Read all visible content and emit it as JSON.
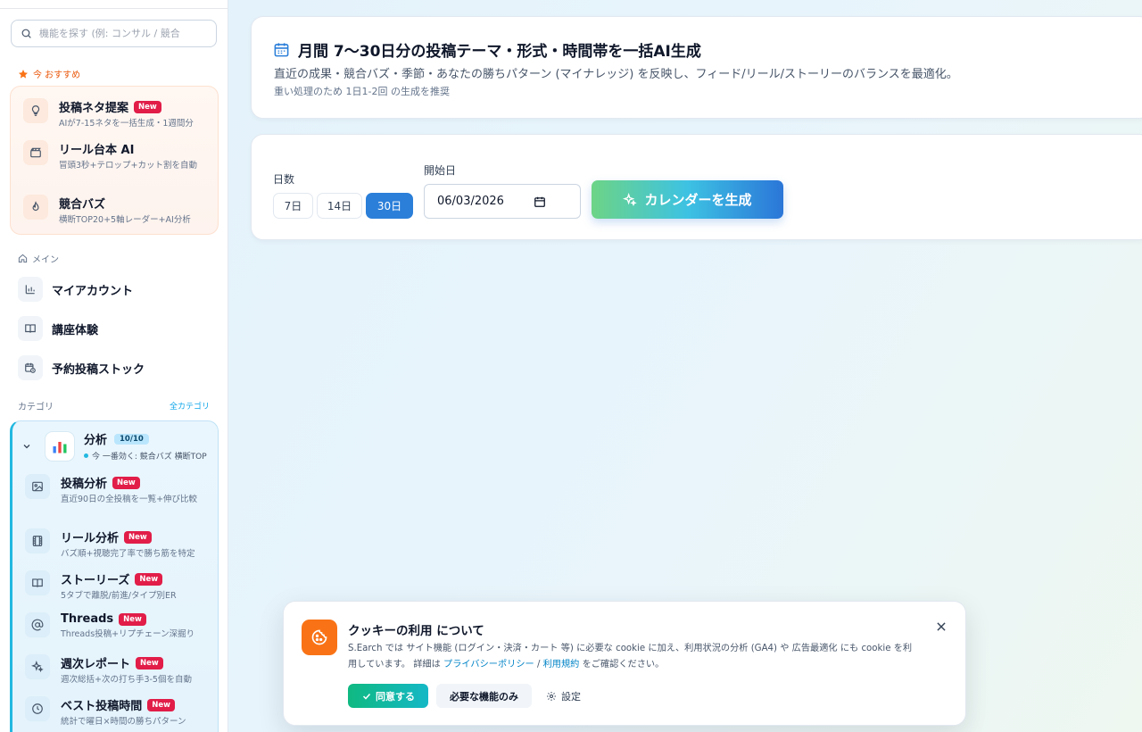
{
  "search": {
    "placeholder": "機能を探す (例: コンサル / 競合"
  },
  "recommended": {
    "heading": "今 おすすめ",
    "items": [
      {
        "title": "投稿ネタ提案",
        "badge": "New",
        "desc": "AIが7-15ネタを一括生成・1週間分"
      },
      {
        "title": "リール台本 AI",
        "badge": "",
        "desc": "冒頭3秒+テロップ+カット割を自動"
      },
      {
        "title": "競合バズ",
        "badge": "",
        "desc": "横断TOP20+5軸レーダー+AI分析"
      }
    ]
  },
  "main_section": {
    "heading": "メイン",
    "items": [
      {
        "label": "マイアカウント"
      },
      {
        "label": "講座体験"
      },
      {
        "label": "予約投稿ストック"
      }
    ]
  },
  "category": {
    "heading": "カテゴリ",
    "all_link": "全カテゴリ",
    "group": {
      "title": "分析",
      "count": "10/10",
      "sub": "今 一番効く: 競合バズ 横断TOP"
    },
    "items": [
      {
        "title": "投稿分析",
        "badge": "New",
        "desc": "直近90日の全投稿を一覧+伸び比較"
      },
      {
        "title": "リール分析",
        "badge": "New",
        "desc": "バズ順+視聴完了率で勝ち筋を特定"
      },
      {
        "title": "ストーリーズ",
        "badge": "New",
        "desc": "5タブで離脱/前進/タイプ別ER"
      },
      {
        "title": "Threads",
        "badge": "New",
        "desc": "Threads投稿+リプチェーン深掘り"
      },
      {
        "title": "週次レポート",
        "badge": "New",
        "desc": "週次総括+次の打ち手3-5個を自動"
      },
      {
        "title": "ベスト投稿時間",
        "badge": "New",
        "desc": "統計で曜日×時間の勝ちパターン"
      }
    ]
  },
  "header_card": {
    "title": "月間 7〜30日分の投稿テーマ・形式・時間帯を一括AI生成",
    "subtitle": "直近の成果・競合バズ・季節・あなたの勝ちパターン (マイナレッジ) を反映し、フィード/リール/ストーリーのバランスを最適化。",
    "note": "重い処理のため 1日1-2回 の生成を推奨"
  },
  "form": {
    "days_label": "日数",
    "day_options": [
      "7日",
      "14日",
      "30日"
    ],
    "selected_day": "30日",
    "start_label": "開始日",
    "start_date": "06/03/2026",
    "generate_button": "カレンダーを生成"
  },
  "cookie": {
    "title": "クッキーの利用 について",
    "text_before": "S.Earch では サイト機能 (ログイン・決済・カート 等) に必要な cookie に加え、利用状況の分析 (GA4) や 広告最適化 にも cookie を利用しています。 詳細は ",
    "privacy_link": "プライバシーポリシー",
    "separator": " / ",
    "terms_link": "利用規約",
    "text_after": " をご確認ください。",
    "accept": "同意する",
    "necessary_only": "必要な機能のみ",
    "settings": "設定"
  },
  "colors": {
    "accent": "#2b7fd9",
    "new_badge": "#e11d48",
    "recommend": "#ea580c",
    "cookie_icon": "#f97316"
  }
}
